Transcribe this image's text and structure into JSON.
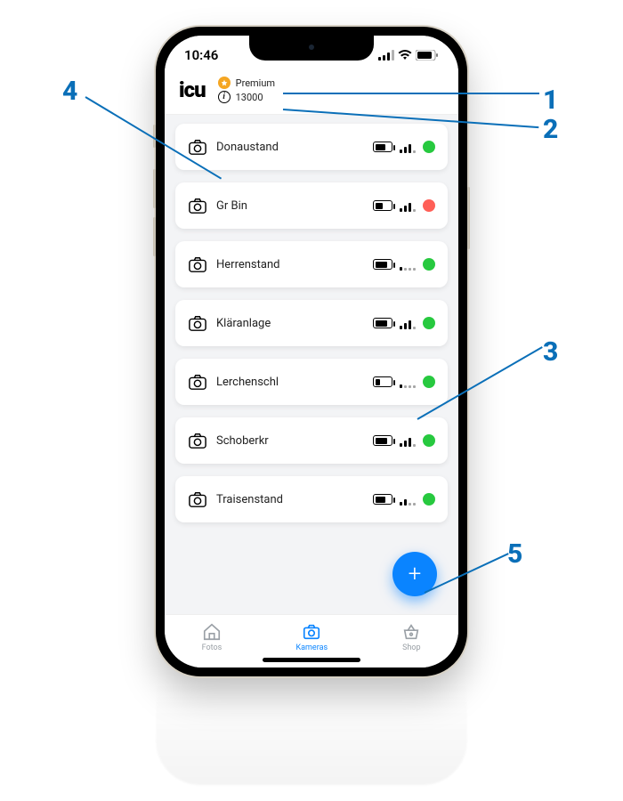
{
  "status_bar": {
    "time": "10:46"
  },
  "header": {
    "logo_text": "icu",
    "premium_label": "Premium",
    "points_value": "13000"
  },
  "cameras": [
    {
      "name": "Donaustand",
      "battery_pct": 70,
      "signal_bars": 3,
      "dot": "green"
    },
    {
      "name": "Gr Bin",
      "battery_pct": 50,
      "signal_bars": 3,
      "dot": "red"
    },
    {
      "name": "Herrenstand",
      "battery_pct": 80,
      "signal_bars": 1,
      "dot": "green"
    },
    {
      "name": "Kläranlage",
      "battery_pct": 80,
      "signal_bars": 3,
      "dot": "green"
    },
    {
      "name": "Lerchenschl",
      "battery_pct": 30,
      "signal_bars": 1,
      "dot": "green"
    },
    {
      "name": "Schoberkr",
      "battery_pct": 80,
      "signal_bars": 3,
      "dot": "green"
    },
    {
      "name": "Traisenstand",
      "battery_pct": 70,
      "signal_bars": 2,
      "dot": "green"
    }
  ],
  "tabs": {
    "fotos": {
      "label": "Fotos"
    },
    "kameras": {
      "label": "Kameras"
    },
    "shop": {
      "label": "Shop"
    }
  },
  "callouts": {
    "c1": "1",
    "c2": "2",
    "c3": "3",
    "c4": "4",
    "c5": "5"
  }
}
